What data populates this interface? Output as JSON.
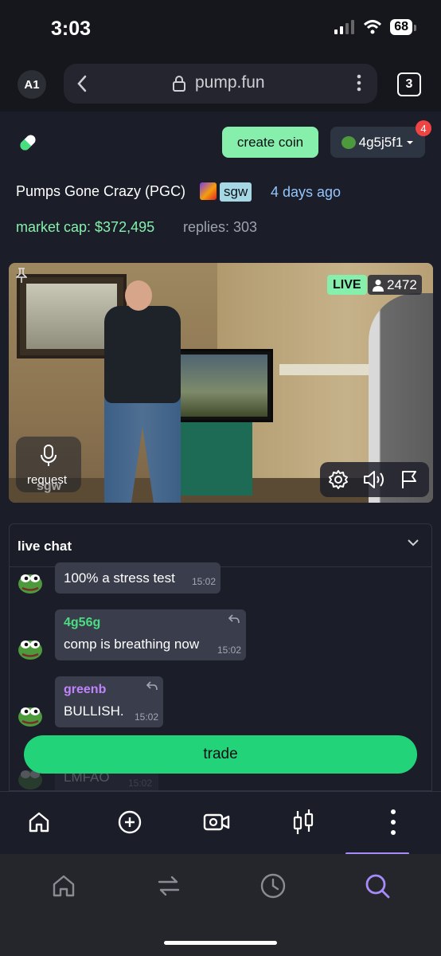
{
  "status_bar": {
    "time": "3:03",
    "battery": "68"
  },
  "browser": {
    "profile": "A1",
    "url": "pump.fun",
    "tab_count": "3"
  },
  "header": {
    "create_label": "create coin",
    "wallet_label": "4g5j5f1",
    "notification_count": "4"
  },
  "coin": {
    "title": "Pumps Gone Crazy (PGC)",
    "creator": "sgw",
    "age": "4 days ago",
    "market_cap": "market cap: $372,495",
    "replies": "replies: 303"
  },
  "stream": {
    "live_label": "LIVE",
    "viewers": "2472",
    "request_label": "request",
    "watermark": "sgw"
  },
  "chat": {
    "title": "live chat",
    "messages": [
      {
        "user": "",
        "text": "100% a stress test",
        "time": "15:02"
      },
      {
        "user": "4g56g",
        "user_color": "#4ade80",
        "text": "comp is breathing now",
        "time": "15:02"
      },
      {
        "user": "greenb",
        "user_color": "#c084fc",
        "text": "BULLISH.",
        "time": "15:02"
      },
      {
        "user": "",
        "text": "LMFAO",
        "time": "15:02"
      }
    ]
  },
  "trade_label": "trade",
  "app_nav": [
    "home-icon",
    "plus-circle-icon",
    "video-camera-icon",
    "chart-candles-icon",
    "more-vertical-icon"
  ],
  "browser_nav": [
    "home-icon",
    "swap-icon",
    "history-icon",
    "search-icon"
  ],
  "colors": {
    "accent_green": "#86efac",
    "trade_green": "#22d37a",
    "active_purple": "#a78bfa",
    "background": "#1b1d28"
  }
}
